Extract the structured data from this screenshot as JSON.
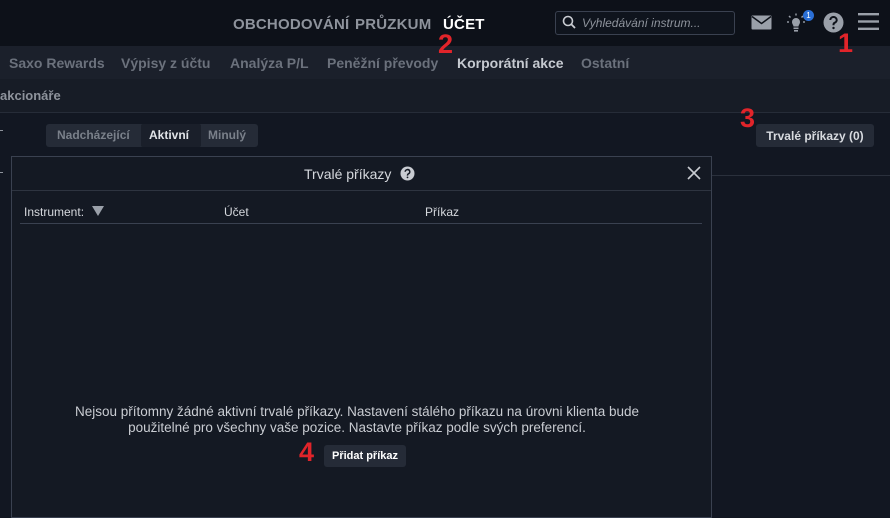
{
  "topnav": {
    "items": [
      "OBCHODOVÁNÍ",
      "PRŮZKUM",
      "ÚČET"
    ],
    "active_index": 2,
    "search_placeholder": "Vyhledávání instrum...",
    "notification_count": "1"
  },
  "subnav": {
    "items": [
      "Saxo Rewards",
      "Výpisy z účtu",
      "Analýza P/L",
      "Peněžní převody",
      "Korporátní akce",
      "Ostatní"
    ],
    "active_index": 4
  },
  "section_label": "akcionáře",
  "filter_tabs": [
    "Nadcházející",
    "Aktivní",
    "Minulý"
  ],
  "filter_active_index": 1,
  "standing_orders_button": "Trvalé příkazy (0)",
  "modal": {
    "title": "Trvalé příkazy",
    "columns": [
      "Instrument:",
      "Účet",
      "Příkaz"
    ],
    "empty_line1": "Nejsou přítomny žádné aktivní trvalé příkazy. Nastavení stálého příkazu na úrovni klienta bude",
    "empty_line2": "použitelné pro všechny vaše pozice. Nastavte příkaz podle svých preferencí.",
    "add_button": "Přidat příkaz"
  },
  "markers": [
    "1",
    "2",
    "3",
    "4"
  ],
  "colors": {
    "background": "#121722",
    "modal_background": "#141923",
    "marker": "#e1242a",
    "badge": "#2a6fd6"
  }
}
